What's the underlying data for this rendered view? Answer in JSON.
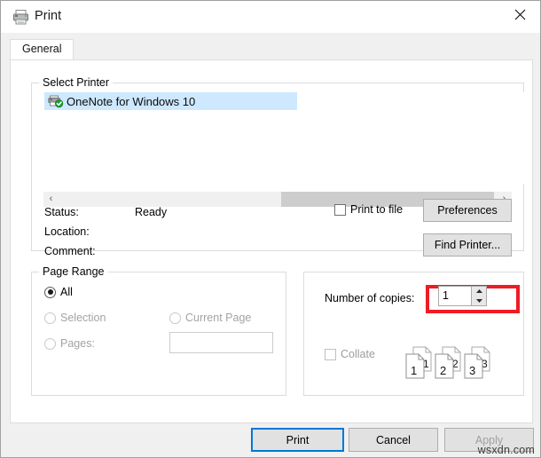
{
  "window": {
    "title": "Print",
    "icon": "printer-icon",
    "close_label": "✕"
  },
  "tabs": [
    {
      "label": "General",
      "selected": true
    }
  ],
  "select_printer": {
    "legend": "Select Printer",
    "printers": [
      {
        "name": "OneNote for Windows 10",
        "icon": "printer-default-icon",
        "selected": true
      }
    ],
    "scrollbar": {
      "left_arrow": "‹",
      "right_arrow": "›"
    },
    "status_label": "Status:",
    "status_value": "Ready",
    "location_label": "Location:",
    "location_value": "",
    "comment_label": "Comment:",
    "comment_value": "",
    "print_to_file_label": "Print to file",
    "print_to_file_checked": false,
    "preferences_label": "Preferences",
    "find_printer_label": "Find Printer...",
    "highlight_color": "#ee1c25"
  },
  "page_range": {
    "legend": "Page Range",
    "options": [
      {
        "label": "All",
        "checked": true,
        "disabled": false
      },
      {
        "label": "Selection",
        "checked": false,
        "disabled": true
      },
      {
        "label": "Current Page",
        "checked": false,
        "disabled": true
      },
      {
        "label": "Pages:",
        "checked": false,
        "disabled": true
      }
    ],
    "pages_value": "",
    "pages_placeholder": ""
  },
  "copies": {
    "number_of_copies_label": "Number of copies:",
    "number_of_copies_value": "1",
    "spinner_up": "up-arrow-icon",
    "spinner_down": "down-arrow-icon",
    "collate_label": "Collate",
    "collate_checked": false,
    "collate_pages": [
      "1",
      "1",
      "2",
      "2",
      "3",
      "3"
    ]
  },
  "footer": {
    "print_label": "Print",
    "cancel_label": "Cancel",
    "apply_label": "Apply",
    "apply_disabled": true,
    "default_button": "Print",
    "watermark": "wsxdn.com"
  }
}
